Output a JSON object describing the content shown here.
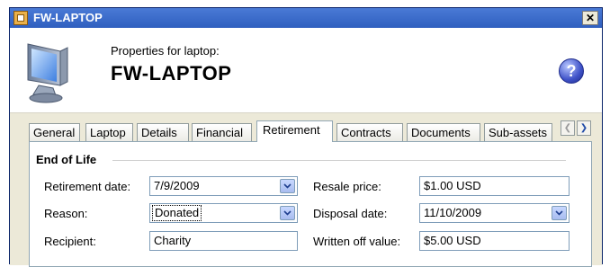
{
  "window": {
    "title": "FW-LAPTOP"
  },
  "header": {
    "subtitle": "Properties for laptop:",
    "title": "FW-LAPTOP"
  },
  "tabs": [
    "General",
    "Laptop",
    "Details",
    "Financial",
    "Retirement",
    "Contracts",
    "Documents",
    "Sub-assets"
  ],
  "active_tab": "Retirement",
  "section": {
    "title": "End of Life"
  },
  "fields": {
    "retirement_date": {
      "label": "Retirement date:",
      "value": "7/9/2009"
    },
    "reason": {
      "label": "Reason:",
      "value": "Donated"
    },
    "recipient": {
      "label": "Recipient:",
      "value": "Charity"
    },
    "resale_price": {
      "label": "Resale price:",
      "value": "$1.00 USD"
    },
    "disposal_date": {
      "label": "Disposal date:",
      "value": "11/10/2009"
    },
    "written_off_value": {
      "label": "Written off value:",
      "value": "$5.00 USD"
    }
  },
  "icons": {
    "app": "properties-window-icon",
    "device": "monitor-icon",
    "help": "help-icon",
    "close": "close-icon",
    "scroll_left": "chevron-left-icon",
    "scroll_right": "chevron-right-icon",
    "dropdown": "chevron-down-icon"
  }
}
